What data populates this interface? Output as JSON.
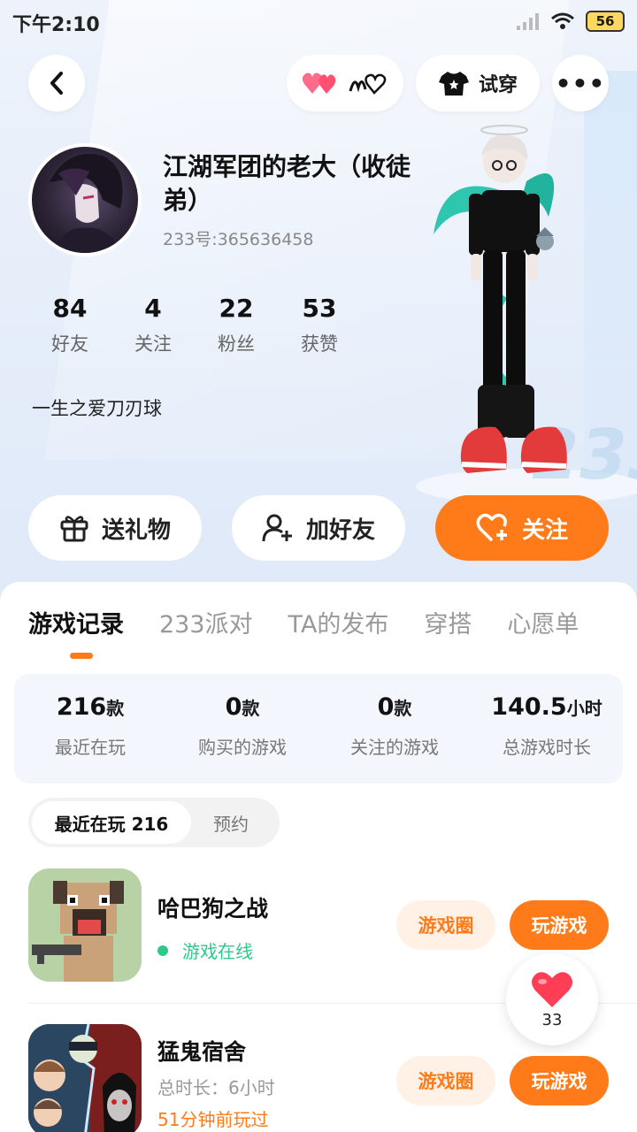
{
  "status": {
    "time": "下午2:10",
    "battery": "56"
  },
  "header": {
    "try_on_label": "试穿",
    "more_label": "•••"
  },
  "profile": {
    "name": "江湖军团的老大（收徒弟）",
    "id_text": "233号:365636458",
    "bio": "一生之爱刀刃球",
    "stats": [
      {
        "num": "84",
        "label": "好友"
      },
      {
        "num": "4",
        "label": "关注"
      },
      {
        "num": "22",
        "label": "粉丝"
      },
      {
        "num": "53",
        "label": "获赞"
      }
    ]
  },
  "actions": {
    "gift": "送礼物",
    "add_friend": "加好友",
    "follow": "关注"
  },
  "tabs": [
    "游戏记录",
    "233派对",
    "TA的发布",
    "穿搭",
    "心愿单"
  ],
  "summary": [
    {
      "num": "216",
      "unit": "款",
      "label": "最近在玩"
    },
    {
      "num": "0",
      "unit": "款",
      "label": "购买的游戏"
    },
    {
      "num": "0",
      "unit": "款",
      "label": "关注的游戏"
    },
    {
      "num": "140.5",
      "unit": "小时",
      "label": "总游戏时长"
    }
  ],
  "subtabs": {
    "recent": "最近在玩 216",
    "reserve": "预约"
  },
  "games": [
    {
      "title": "哈巴狗之战",
      "status": "游戏在线",
      "circle": "游戏圈",
      "play": "玩游戏"
    },
    {
      "title": "猛鬼宿舍",
      "duration": "总时长：6小时",
      "last_played": "51分钟前玩过",
      "circle": "游戏圈",
      "play": "玩游戏"
    }
  ],
  "floating_like": {
    "count": "33"
  },
  "colors": {
    "accent": "#ff7a18",
    "online": "#2dc98a"
  }
}
